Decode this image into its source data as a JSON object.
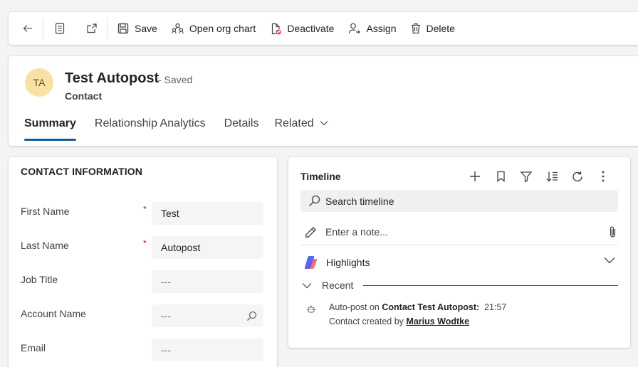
{
  "commandbar": {
    "save_label": "Save",
    "open_org_chart_label": "Open org chart",
    "deactivate_label": "Deactivate",
    "assign_label": "Assign",
    "delete_label": "Delete"
  },
  "record": {
    "initials": "TA",
    "title": "Test Autopost",
    "status": "- Saved",
    "entity": "Contact",
    "avatar_color": "#f9e1a6"
  },
  "tabs": [
    {
      "label": "Summary"
    },
    {
      "label": "Relationship Analytics"
    },
    {
      "label": "Details"
    },
    {
      "label": "Related"
    }
  ],
  "contact_info": {
    "section_title": "CONTACT INFORMATION",
    "required_marker": "*",
    "fields": [
      {
        "label": "First Name",
        "value": "Test"
      },
      {
        "label": "Last Name",
        "value": "Autopost"
      },
      {
        "label": "Job Title",
        "value": "---"
      },
      {
        "label": "Account Name",
        "value": "---"
      },
      {
        "label": "Email",
        "value": "---"
      }
    ]
  },
  "timeline": {
    "title": "Timeline",
    "search_placeholder": "Search timeline",
    "note_placeholder": "Enter a note...",
    "highlights_label": "Highlights",
    "recent_label": "Recent",
    "item": {
      "prefix": "Auto-post on ",
      "subject": "Contact Test Autopost:",
      "time": "21:57",
      "line2_prefix": "Contact created by ",
      "author": "Marius Wodtke"
    }
  },
  "colors": {
    "accent": "#115ea3",
    "required": "#c50f1f"
  }
}
